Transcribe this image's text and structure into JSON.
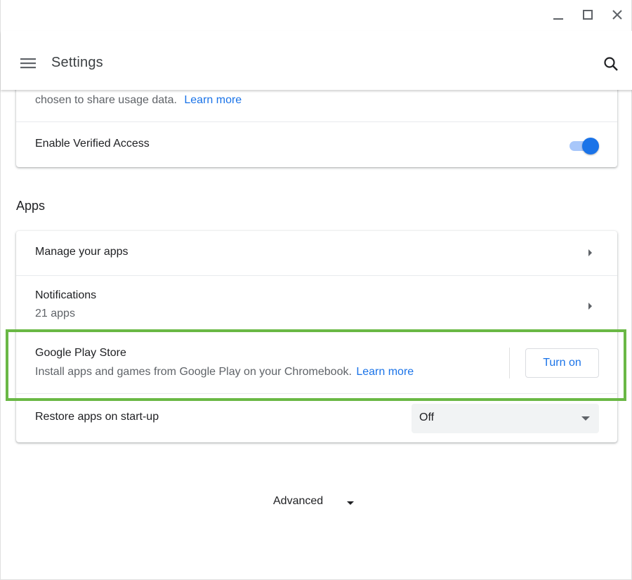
{
  "window": {
    "controls": [
      "minimize",
      "maximize",
      "close"
    ]
  },
  "header": {
    "title": "Settings",
    "menu_icon": "hamburger-menu-icon",
    "search_icon": "search-icon"
  },
  "privacy_card": {
    "partial_text": "chosen to share usage data.",
    "learn_more": "Learn more",
    "verified_access": {
      "label": "Enable Verified Access",
      "enabled": true
    }
  },
  "apps": {
    "section_title": "Apps",
    "manage_apps": {
      "label": "Manage your apps"
    },
    "notifications": {
      "label": "Notifications",
      "sub": "21 apps"
    },
    "play_store": {
      "label": "Google Play Store",
      "description": "Install apps and games from Google Play on your Chromebook.",
      "learn_more": "Learn more",
      "button": "Turn on"
    },
    "restore": {
      "label": "Restore apps on start-up",
      "selected": "Off"
    }
  },
  "advanced": {
    "label": "Advanced"
  },
  "colors": {
    "accent": "#1a73e8",
    "highlight": "#6ab845",
    "toggle_track": "#a8c7fa"
  }
}
